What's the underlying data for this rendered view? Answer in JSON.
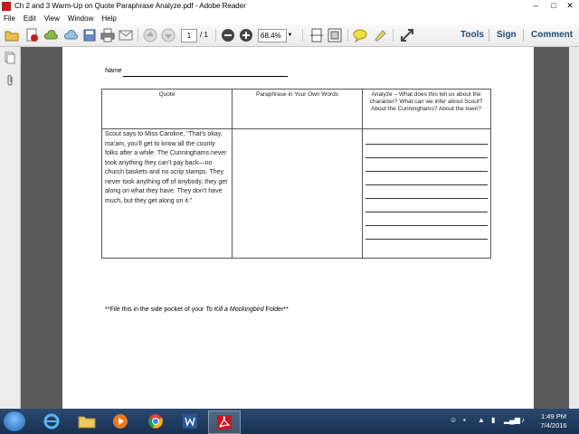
{
  "window": {
    "title": "Ch 2 and 3 Warm-Up on Quote Paraphrase Analyze.pdf - Adobe Reader",
    "minimize": "–",
    "maximize": "□",
    "close": "✕"
  },
  "menu": [
    "File",
    "Edit",
    "View",
    "Window",
    "Help"
  ],
  "toolbar": {
    "page_current": "1",
    "page_total": "/ 1",
    "zoom": "68.4%",
    "zoom_dropdown": "▼",
    "tools": "Tools",
    "sign": "Sign",
    "comment": "Comment"
  },
  "doc": {
    "name_label": "Name",
    "headers": {
      "quote": "Quote",
      "paraphrase": "Paraphrase in Your Own Words",
      "analyze": "Analyze – What does this tell us about the character? What can we infer about Scout? About the Cunninghams? About the town?"
    },
    "quote_text": "Scout says to Miss Caroline, “That’s okay, ma’am, you’ll get to know all the county folks after a while. The Cunninghams never took anything they can’t pay back—no church baskets and no scrip stamps. They never took anything off of anybody, they get along on what they have. They don’t have much, but they get along on it.”",
    "footnote_prefix": "**File this in the side pocket of your ",
    "footnote_title": "To Kill a Mockingbird",
    "footnote_suffix": " Folder**"
  },
  "taskbar": {
    "clock_time": "1:49 PM",
    "clock_date": "7/4/2016"
  },
  "colors": {
    "accent": "#1e4a7a",
    "taskbar": "#1f3a5c",
    "pdf_red": "#c8181e"
  }
}
